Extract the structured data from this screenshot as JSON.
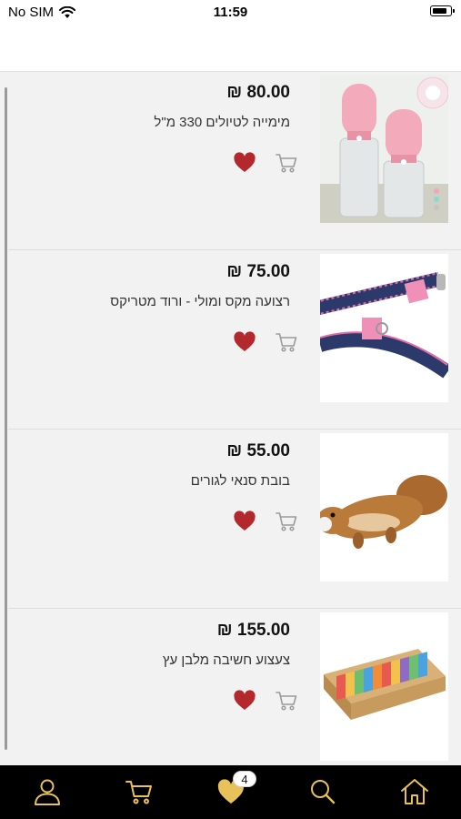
{
  "status_bar": {
    "carrier": "No SIM",
    "time": "11:59",
    "battery_level": 0.85
  },
  "products": [
    {
      "price": "80.00 ₪",
      "name": "מימייה לטיולים 330 מ\"ל",
      "image": "pink-water-bottles",
      "favorited": true
    },
    {
      "price": "75.00 ₪",
      "name": "רצועה מקס ומולי - ורוד מטריקס",
      "image": "navy-pink-leash",
      "favorited": true
    },
    {
      "price": "55.00 ₪",
      "name": "בובת סנאי לגורים",
      "image": "brown-squirrel-toy",
      "favorited": true
    },
    {
      "price": "155.00 ₪",
      "name": "צעצוע חשיבה מלבן עץ",
      "image": "wooden-puzzle-toy",
      "favorited": true
    }
  ],
  "tab_bar": {
    "tabs": [
      "profile-icon",
      "cart-icon",
      "favorites-icon",
      "search-icon",
      "home-icon"
    ],
    "favorites_badge": "4"
  },
  "colors": {
    "accent_gold": "#e8c15a",
    "heart_red": "#b3282d",
    "tab_bar_bg": "#000000"
  }
}
